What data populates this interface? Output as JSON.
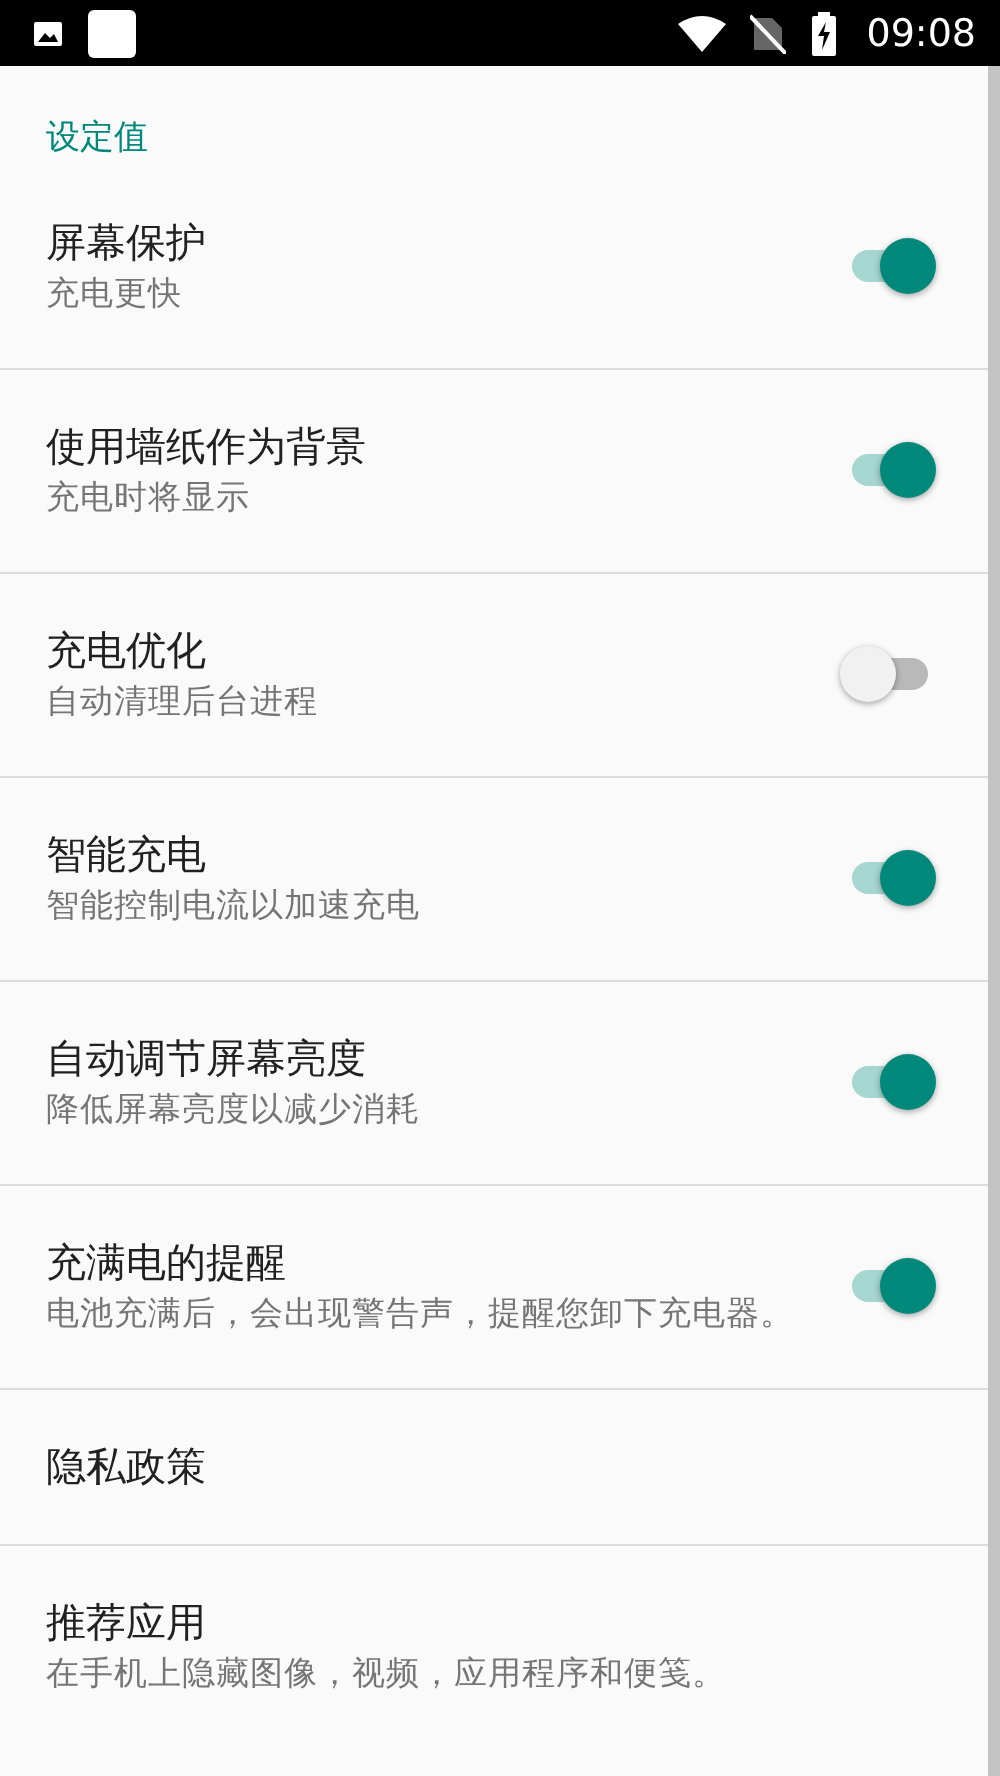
{
  "status_bar": {
    "time": "09:08"
  },
  "section": {
    "title": "设定值"
  },
  "settings": [
    {
      "kind": "switch",
      "title": "屏幕保护",
      "subtitle": "充电更快",
      "on": true
    },
    {
      "kind": "switch",
      "title": "使用墙纸作为背景",
      "subtitle": "充电时将显示",
      "on": true
    },
    {
      "kind": "switch",
      "title": "充电优化",
      "subtitle": "自动清理后台进程",
      "on": false
    },
    {
      "kind": "switch",
      "title": "智能充电",
      "subtitle": "智能控制电流以加速充电",
      "on": true
    },
    {
      "kind": "switch",
      "title": "自动调节屏幕亮度",
      "subtitle": "降低屏幕亮度以减少消耗",
      "on": true
    },
    {
      "kind": "switch",
      "title": "充满电的提醒",
      "subtitle": "电池充满后，会出现警告声，提醒您卸下充电器。",
      "on": true
    },
    {
      "kind": "link",
      "title": "隐私政策"
    },
    {
      "kind": "link",
      "title": "推荐应用",
      "subtitle": "在手机上隐藏图像，视频，应用程序和便笺。"
    }
  ]
}
